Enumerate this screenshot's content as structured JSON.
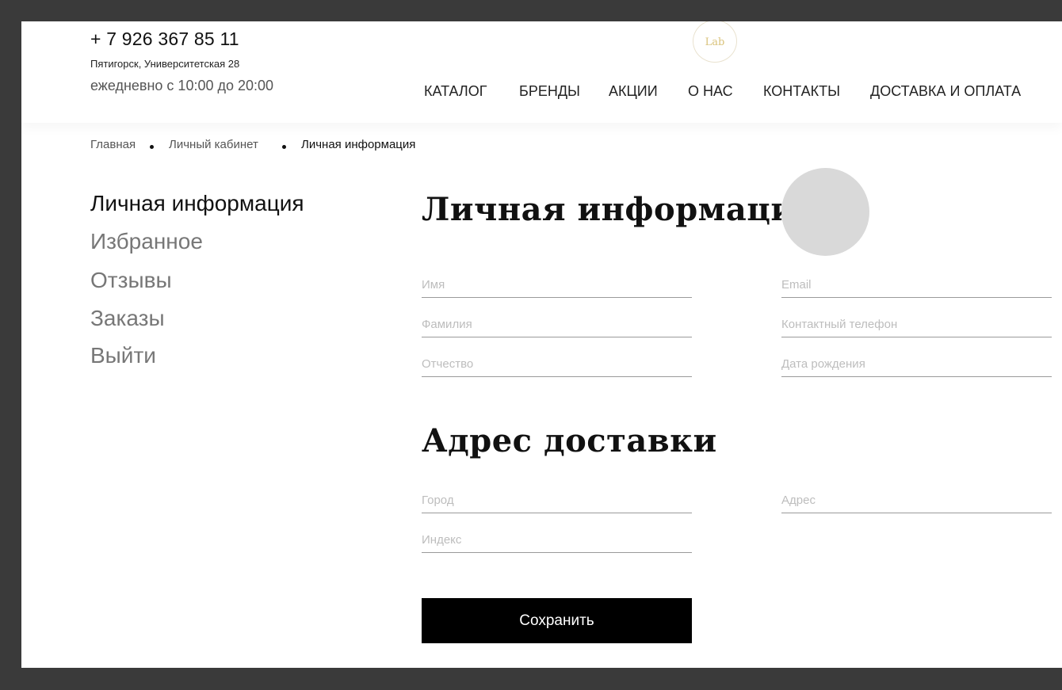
{
  "header": {
    "phone": "+ 7 926 367 85 11",
    "address": "Пятигорск, Университетская 28",
    "hours": "ежедневно с 10:00 до 20:00",
    "logo_text": "Lab",
    "nav": [
      "КАТАЛОГ",
      "БРЕНДЫ",
      "АКЦИИ",
      "О НАС",
      "КОНТАКТЫ",
      "ДОСТАВКА И ОПЛАТА"
    ]
  },
  "breadcrumb": [
    "Главная",
    "Личный кабинет",
    "Личная информация"
  ],
  "sidebar": {
    "items": [
      "Личная информация",
      "Избранное",
      "Отзывы",
      "Заказы",
      "Выйти"
    ]
  },
  "personal": {
    "title": "Личная информация",
    "fields": {
      "first_name": {
        "placeholder": "Имя",
        "value": ""
      },
      "last_name": {
        "placeholder": "Фамилия",
        "value": ""
      },
      "middle_name": {
        "placeholder": "Отчество",
        "value": ""
      },
      "email": {
        "placeholder": "Email",
        "value": ""
      },
      "phone": {
        "placeholder": "Контактный телефон",
        "value": ""
      },
      "birth_date": {
        "placeholder": "Дата рождения",
        "value": ""
      }
    }
  },
  "delivery": {
    "title": "Адрес доставки",
    "fields": {
      "city": {
        "placeholder": "Город",
        "value": ""
      },
      "index": {
        "placeholder": "Индекс",
        "value": ""
      },
      "address": {
        "placeholder": "Адрес",
        "value": ""
      }
    }
  },
  "save_label": "Сохранить",
  "colors": {
    "frame": "#3a3a3a",
    "background": "#ffffff",
    "button": "#000000",
    "avatar": "#d9d9d9",
    "logo_gold": "#d9c27a"
  }
}
